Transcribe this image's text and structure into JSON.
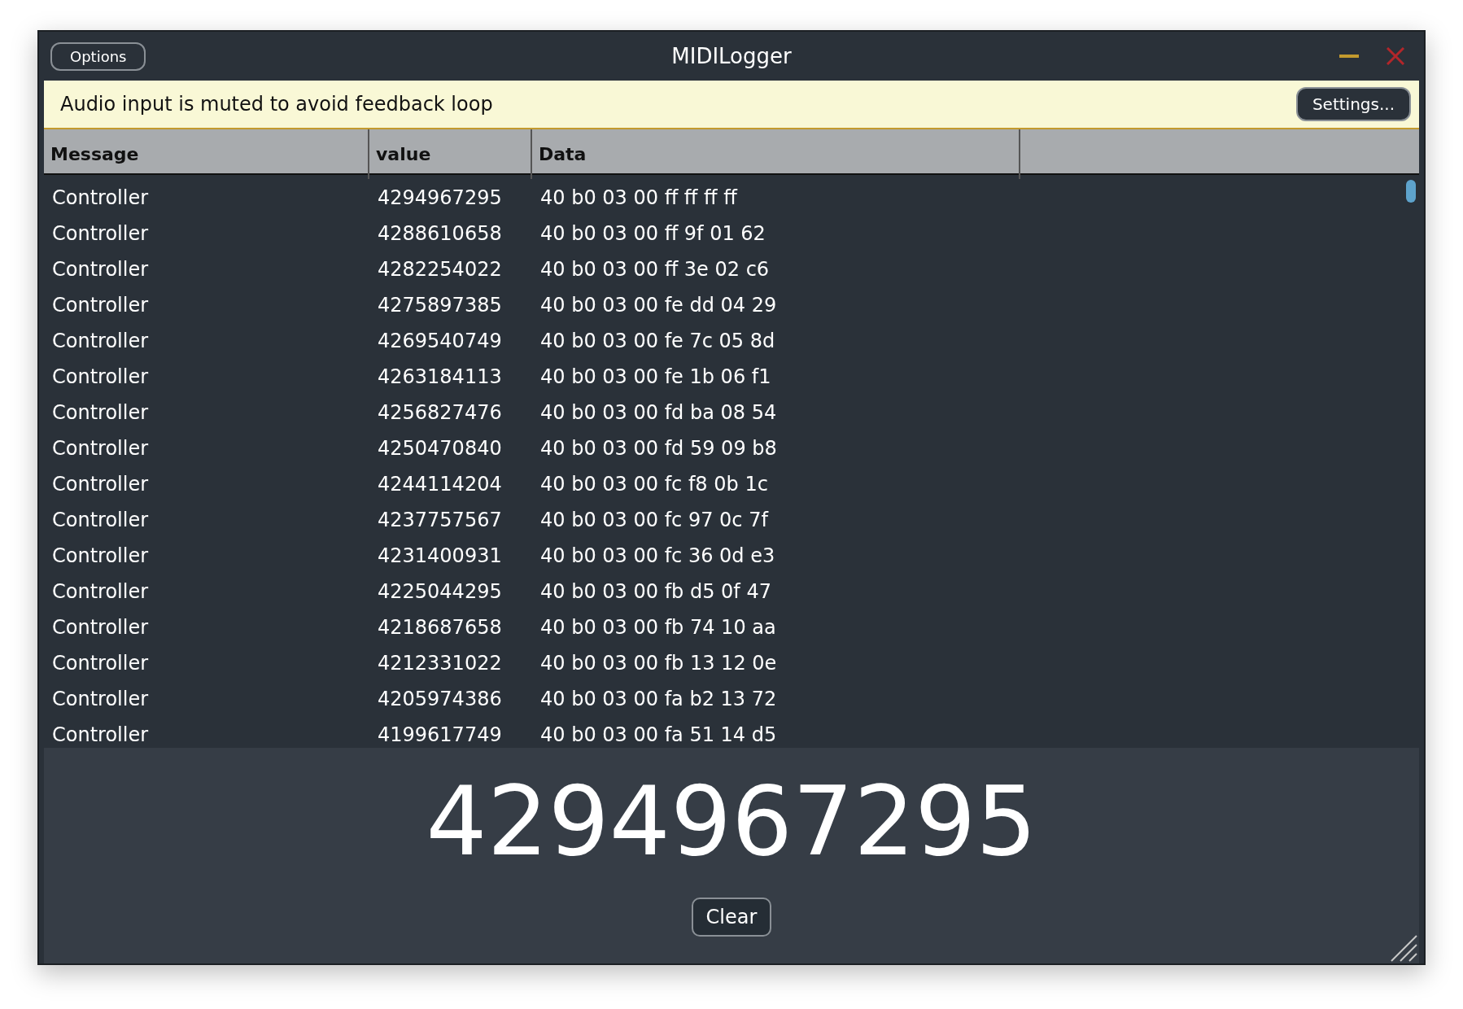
{
  "window": {
    "title": "MIDILogger",
    "options_button": "Options"
  },
  "banner": {
    "message": "Audio input is muted to avoid feedback loop",
    "button": "Settings..."
  },
  "table": {
    "columns": [
      "Message",
      "value",
      "Data"
    ],
    "rows": [
      {
        "message": "Controller",
        "value": "4294967295",
        "data": "40 b0 03 00 ff ff ff ff"
      },
      {
        "message": "Controller",
        "value": "4288610658",
        "data": "40 b0 03 00 ff 9f 01 62"
      },
      {
        "message": "Controller",
        "value": "4282254022",
        "data": "40 b0 03 00 ff 3e 02 c6"
      },
      {
        "message": "Controller",
        "value": "4275897385",
        "data": "40 b0 03 00 fe dd 04 29"
      },
      {
        "message": "Controller",
        "value": "4269540749",
        "data": "40 b0 03 00 fe 7c 05 8d"
      },
      {
        "message": "Controller",
        "value": "4263184113",
        "data": "40 b0 03 00 fe 1b 06 f1"
      },
      {
        "message": "Controller",
        "value": "4256827476",
        "data": "40 b0 03 00 fd ba 08 54"
      },
      {
        "message": "Controller",
        "value": "4250470840",
        "data": "40 b0 03 00 fd 59 09 b8"
      },
      {
        "message": "Controller",
        "value": "4244114204",
        "data": "40 b0 03 00 fc f8 0b 1c"
      },
      {
        "message": "Controller",
        "value": "4237757567",
        "data": "40 b0 03 00 fc 97 0c 7f"
      },
      {
        "message": "Controller",
        "value": "4231400931",
        "data": "40 b0 03 00 fc 36 0d e3"
      },
      {
        "message": "Controller",
        "value": "4225044295",
        "data": "40 b0 03 00 fb d5 0f 47"
      },
      {
        "message": "Controller",
        "value": "4218687658",
        "data": "40 b0 03 00 fb 74 10 aa"
      },
      {
        "message": "Controller",
        "value": "4212331022",
        "data": "40 b0 03 00 fb 13 12 0e"
      },
      {
        "message": "Controller",
        "value": "4205974386",
        "data": "40 b0 03 00 fa b2 13 72"
      },
      {
        "message": "Controller",
        "value": "4199617749",
        "data": "40 b0 03 00 fa 51 14 d5"
      }
    ]
  },
  "display": {
    "value": "4294967295",
    "button": "Clear"
  }
}
